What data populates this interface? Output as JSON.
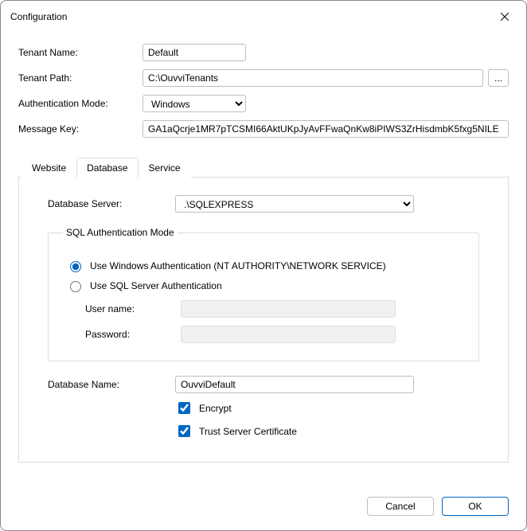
{
  "window": {
    "title": "Configuration"
  },
  "form": {
    "tenant_name_label": "Tenant Name:",
    "tenant_name_value": "Default",
    "tenant_path_label": "Tenant Path:",
    "tenant_path_value": "C:\\OuvviTenants",
    "browse_label": "...",
    "auth_mode_label": "Authentication Mode:",
    "auth_mode_value": "Windows",
    "message_key_label": "Message Key:",
    "message_key_value": "GA1aQcrje1MR7pTCSMI66AktUKpJyAvFFwaQnKw8iPIWS3ZrHisdmbK5fxg5NILE"
  },
  "tabs": {
    "website": "Website",
    "database": "Database",
    "service": "Service"
  },
  "db": {
    "server_label": "Database Server:",
    "server_value": ".\\SQLEXPRESS",
    "fieldset_legend": "SQL Authentication Mode",
    "radio_windows": "Use Windows Authentication (NT AUTHORITY\\NETWORK SERVICE)",
    "radio_sql": "Use SQL Server Authentication",
    "user_label": "User name:",
    "user_value": "",
    "pass_label": "Password:",
    "pass_value": "",
    "name_label": "Database Name:",
    "name_value": "OuvviDefault",
    "encrypt_label": "Encrypt",
    "trust_label": "Trust Server Certificate"
  },
  "footer": {
    "cancel": "Cancel",
    "ok": "OK"
  }
}
